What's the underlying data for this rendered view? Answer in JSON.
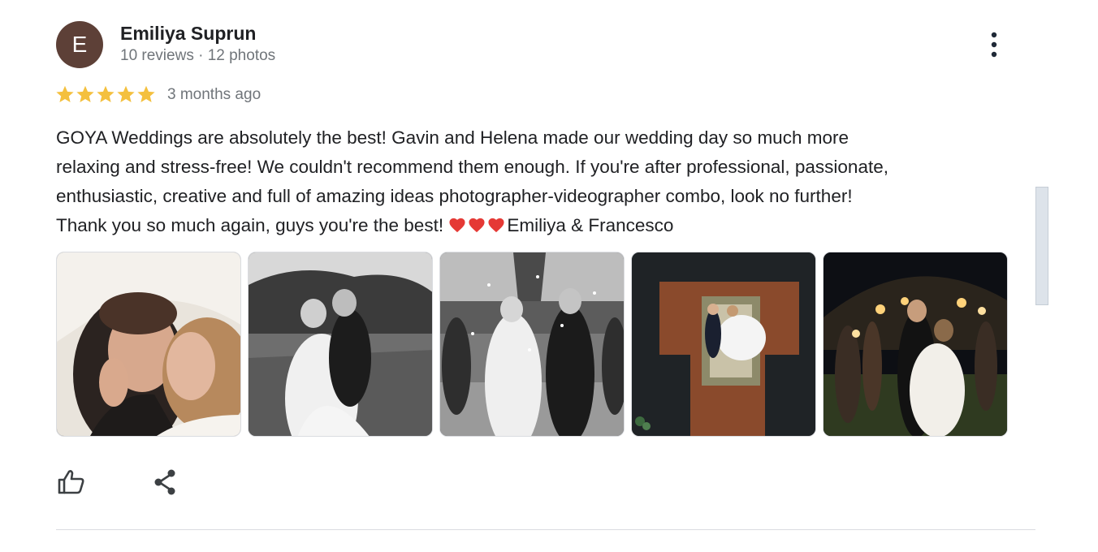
{
  "reviewer": {
    "avatar_initial": "E",
    "avatar_color": "#5d4037",
    "name": "Emiliya Suprun",
    "meta": "10 reviews · 12 photos"
  },
  "rating": {
    "stars": 5,
    "max_stars": 5,
    "star_color": "#f4c03e",
    "date": "3 months ago"
  },
  "review": {
    "lines": [
      "GOYA Weddings are absolutely the best! Gavin and Helena made our wedding day so much more",
      "relaxing and stress-free! We couldn't recommend them enough. If you're after professional, passionate,",
      "enthusiastic, creative and full of amazing ideas photographer-videographer combo, look no further!",
      "Thank you so much again, guys you're the best! "
    ],
    "hearts": 3,
    "heart_color": "#e53935",
    "signoff": "Emiliya & Francesco"
  },
  "photos": [
    {
      "icon": "couple-veil-photo"
    },
    {
      "icon": "couple-field-bw-photo"
    },
    {
      "icon": "couple-confetti-bw-photo"
    },
    {
      "icon": "aerial-couple-photo"
    },
    {
      "icon": "couple-sparklers-photo"
    }
  ],
  "actions": {
    "like_icon": "thumb-up-icon",
    "share_icon": "share-icon",
    "more_icon": "more-vert-icon"
  }
}
